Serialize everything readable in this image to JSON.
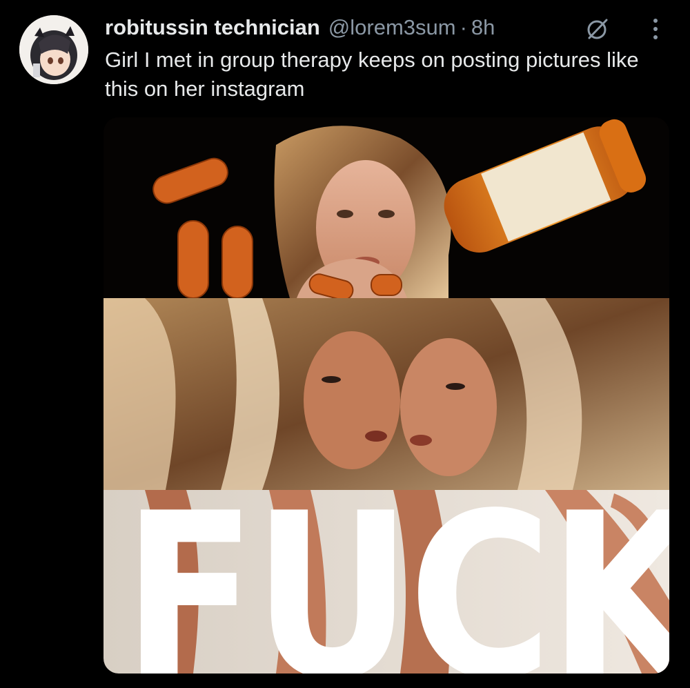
{
  "post": {
    "author": {
      "display_name": "robitussin technician",
      "handle": "@lorem3sum",
      "separator": "·",
      "time": "8h",
      "avatar_icon": "anime-avatar-icon"
    },
    "text": "Girl I met in group therapy keeps on posting pictures like this on her instagram",
    "actions": {
      "grok_icon": "grok-icon",
      "more_icon": "more-dots-icon"
    },
    "media": {
      "overlay_text": "FUCK"
    }
  },
  "colors": {
    "background": "#000000",
    "primary_text": "#e7e9ea",
    "secondary_text": "#8b98a5",
    "pill_orange": "#d2621e"
  }
}
